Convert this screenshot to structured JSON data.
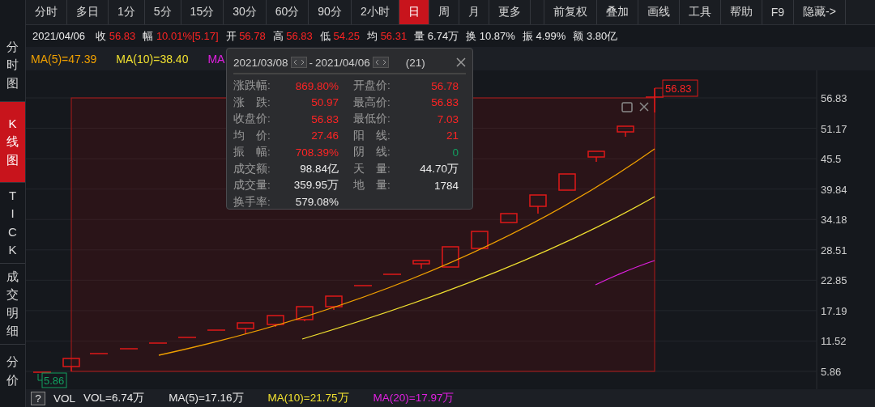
{
  "sidebar": {
    "tabs": [
      {
        "label": "分时图",
        "selected": false
      },
      {
        "label": "K线图",
        "selected": true
      },
      {
        "label": "TICK",
        "selected": false
      },
      {
        "label": "成交明细",
        "selected": false
      },
      {
        "label": "分价",
        "selected": false
      }
    ]
  },
  "toolbar": {
    "periods": [
      {
        "label": "分时",
        "selected": false
      },
      {
        "label": "多日",
        "selected": false
      },
      {
        "label": "1分",
        "selected": false
      },
      {
        "label": "5分",
        "selected": false
      },
      {
        "label": "15分",
        "selected": false
      },
      {
        "label": "30分",
        "selected": false
      },
      {
        "label": "60分",
        "selected": false
      },
      {
        "label": "90分",
        "selected": false
      },
      {
        "label": "2小时",
        "selected": false
      },
      {
        "label": "日",
        "selected": true
      },
      {
        "label": "周",
        "selected": false
      },
      {
        "label": "月",
        "selected": false
      },
      {
        "label": "更多",
        "selected": false
      }
    ],
    "tools": [
      "前复权",
      "叠加",
      "画线",
      "工具",
      "帮助",
      "F9",
      "隐藏->"
    ]
  },
  "quote": {
    "date": "2021/04/06",
    "items": [
      {
        "label": "收",
        "value": "56.83",
        "color": "#ff2424"
      },
      {
        "label": "幅",
        "value": "10.01%[5.17]",
        "color": "#ff2424"
      },
      {
        "label": "开",
        "value": "56.78",
        "color": "#ff2424"
      },
      {
        "label": "高",
        "value": "56.83",
        "color": "#ff2424"
      },
      {
        "label": "低",
        "value": "54.25",
        "color": "#ff2424"
      },
      {
        "label": "均",
        "value": "56.31",
        "color": "#ff2424"
      },
      {
        "label": "量",
        "value": "6.74万",
        "color": "#e8e8e8"
      },
      {
        "label": "换",
        "value": "10.87%",
        "color": "#e8e8e8"
      },
      {
        "label": "振",
        "value": "4.99%",
        "color": "#e8e8e8"
      },
      {
        "label": "额",
        "value": "3.80亿",
        "color": "#e8e8e8"
      }
    ]
  },
  "ma_legend": [
    {
      "text": "MA(5)=47.39",
      "color": "#f0a000"
    },
    {
      "text": "MA(10)=38.40",
      "color": "#f0e030"
    },
    {
      "text": "MA",
      "color": "#e020e0"
    }
  ],
  "chart": {
    "y_axis_labels": [
      "56.83",
      "51.17",
      "45.5",
      "39.84",
      "34.18",
      "28.51",
      "22.85",
      "17.19",
      "11.52",
      "5.86"
    ],
    "high_tag": "56.83",
    "low_tag": "5.86"
  },
  "range_popup": {
    "start_date": "2021/03/08",
    "separator": "-",
    "end_date": "2021/04/06",
    "count": "(21)",
    "stats": [
      {
        "label": "涨跌幅:",
        "value": "869.80%",
        "color": "#ff2424"
      },
      {
        "label": "开盘价:",
        "value": "56.78",
        "color": "#ff2424"
      },
      {
        "label": "涨　跌:",
        "value": "50.97",
        "color": "#ff2424"
      },
      {
        "label": "最高价:",
        "value": "56.83",
        "color": "#ff2424"
      },
      {
        "label": "收盘价:",
        "value": "56.83",
        "color": "#ff2424"
      },
      {
        "label": "最低价:",
        "value": "7.03",
        "color": "#ff2424"
      },
      {
        "label": "均　价:",
        "value": "27.46",
        "color": "#ff2424"
      },
      {
        "label": "阳　线:",
        "value": "21",
        "color": "#ff2424"
      },
      {
        "label": "振　幅:",
        "value": "708.39%",
        "color": "#ff2424"
      },
      {
        "label": "阴　线:",
        "value": "0",
        "color": "#12a060"
      },
      {
        "label": "成交额:",
        "value": "98.84亿",
        "color": "#ececec"
      },
      {
        "label": "天　量:",
        "value": "44.70万",
        "color": "#ececec"
      },
      {
        "label": "成交量:",
        "value": "359.95万",
        "color": "#ececec"
      },
      {
        "label": "地　量:",
        "value": "1784",
        "color": "#ececec"
      },
      {
        "label": "换手率:",
        "value": "579.08%",
        "color": "#ececec"
      }
    ]
  },
  "volume_bar": {
    "help": "?",
    "label": "VOL",
    "items": [
      {
        "text": "VOL=6.74万",
        "color": "#e8e8e8"
      },
      {
        "text": "MA(5)=17.16万",
        "color": "#e8e8e8"
      },
      {
        "text": "MA(10)=21.75万",
        "color": "#f0e030"
      },
      {
        "text": "MA(20)=17.97万",
        "color": "#e020e0"
      }
    ]
  }
}
